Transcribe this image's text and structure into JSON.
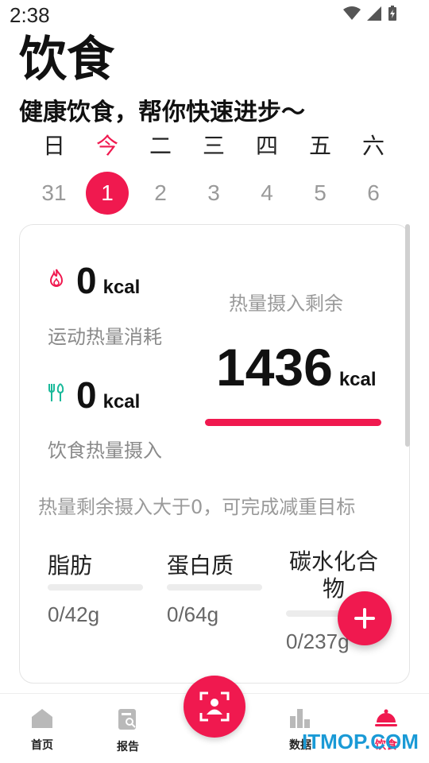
{
  "status": {
    "time": "2:38"
  },
  "header": {
    "title": "饮食",
    "subtitle": "健康饮食，帮你快速进步～"
  },
  "calendar": {
    "weekdays": [
      "日",
      "今",
      "二",
      "三",
      "四",
      "五",
      "六"
    ],
    "dates": [
      "31",
      "1",
      "2",
      "3",
      "4",
      "5",
      "6"
    ],
    "active_index": 1
  },
  "summary": {
    "burn": {
      "value": "0",
      "unit": "kcal",
      "label": "运动热量消耗",
      "icon": "flame-icon"
    },
    "intake": {
      "value": "0",
      "unit": "kcal",
      "label": "饮食热量摄入",
      "icon": "fork-spoon-icon"
    },
    "remaining": {
      "label": "热量摄入剩余",
      "value": "1436",
      "unit": "kcal",
      "progress_fraction": 1.0
    },
    "hint": "热量剩余摄入大于0，可完成减重目标"
  },
  "nutrients": [
    {
      "name": "脂肪",
      "value": "0/42g",
      "progress_fraction": 0
    },
    {
      "name": "蛋白质",
      "value": "0/64g",
      "progress_fraction": 0
    },
    {
      "name": "碳水化合物",
      "value": "0/237g",
      "progress_fraction": 0
    }
  ],
  "tabs": [
    {
      "label": "首页",
      "icon": "home-icon"
    },
    {
      "label": "报告",
      "icon": "report-icon"
    },
    {
      "label": "数据",
      "icon": "bar-chart-icon"
    },
    {
      "label": "饮食",
      "icon": "cloche-icon"
    }
  ],
  "watermark": "ITMOP.COM",
  "colors": {
    "accent": "#f0194f",
    "teal": "#19b99a",
    "watermark": "#1a9ad6"
  }
}
